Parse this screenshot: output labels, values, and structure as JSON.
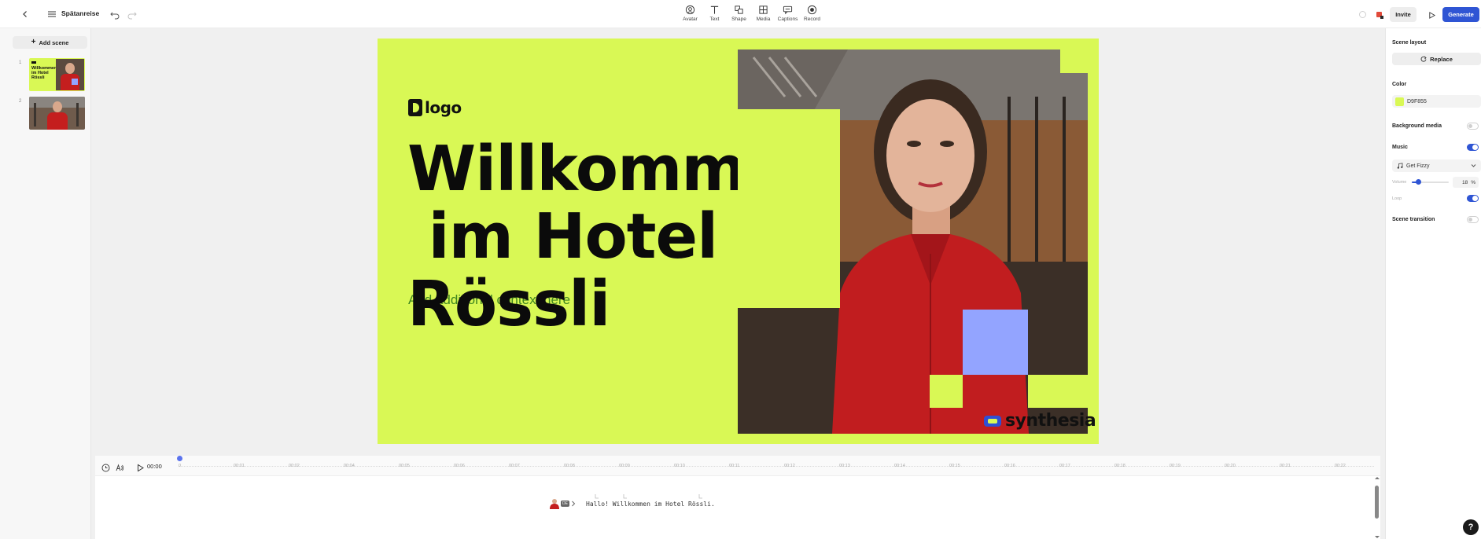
{
  "topbar": {
    "title": "Spätanreise",
    "tools": [
      {
        "label": "Avatar",
        "icon": "avatar-icon"
      },
      {
        "label": "Text",
        "icon": "text-icon"
      },
      {
        "label": "Shape",
        "icon": "shape-icon"
      },
      {
        "label": "Media",
        "icon": "media-icon"
      },
      {
        "label": "Captions",
        "icon": "captions-icon"
      },
      {
        "label": "Record",
        "icon": "record-icon"
      }
    ],
    "invite_label": "Invite",
    "generate_label": "Generate"
  },
  "scenes": {
    "add_label": "Add scene",
    "items": [
      {
        "number": "1",
        "thumb_text": "Willkommen im Hotel Rössli"
      },
      {
        "number": "2"
      }
    ]
  },
  "canvas": {
    "background_color": "#D9F855",
    "logo_text": "logo",
    "headline_line1": "Willkommen",
    "headline_line2": " im Hotel",
    "headline_line3": "Rössli",
    "subline": "Add additional context here",
    "brand_text": "synthesia"
  },
  "timeline": {
    "time": "00:00",
    "ticks": [
      "0",
      "00:01",
      "00:02",
      "00:04",
      "00:05",
      "00:06",
      "00:07",
      "00:08",
      "00:09",
      "00:10",
      "00:11",
      "00:12",
      "00:13",
      "00:14",
      "00:15",
      "00:16",
      "00:17",
      "00:18",
      "00:19",
      "00:20",
      "00:21",
      "00:22"
    ],
    "script": "Hallo! Willkommen im Hotel Rössli.",
    "avatar_badge": "DE"
  },
  "rightpanel": {
    "scene_layout_label": "Scene layout",
    "replace_label": "Replace",
    "color_label": "Color",
    "color_value": "D9F855",
    "background_media_label": "Background media",
    "background_media_on": false,
    "music_label": "Music",
    "music_on": true,
    "music_track": "Get Fizzy",
    "volume_label": "Volume",
    "volume_value": "18",
    "volume_unit": "%",
    "loop_label": "Loop",
    "loop_on": true,
    "scene_transition_label": "Scene transition",
    "scene_transition_on": false
  },
  "help_label": "?"
}
